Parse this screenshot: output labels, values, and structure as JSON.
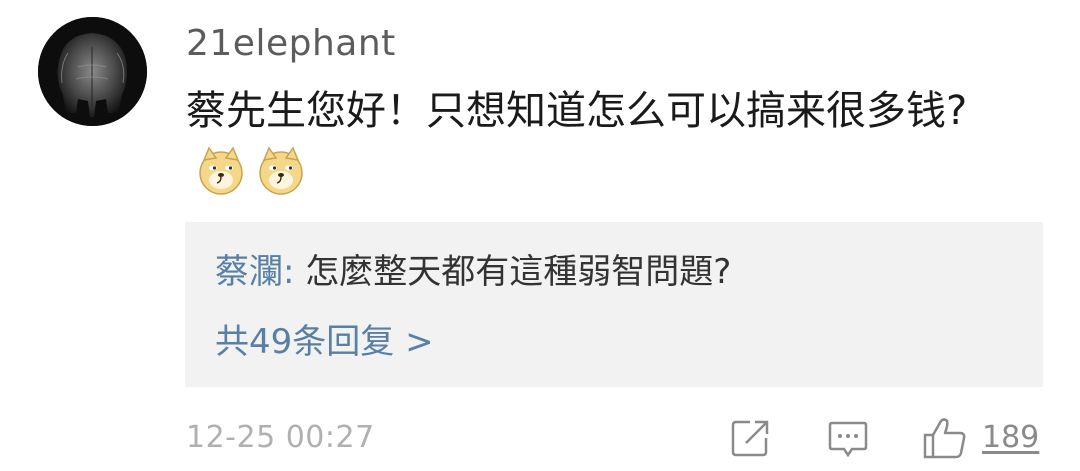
{
  "comment": {
    "username": "21elephant",
    "avatar_icon": "elephant-avatar",
    "text": "蔡先生您好！只想知道怎么可以搞来很多钱?",
    "emojis": [
      "doge-emoji",
      "doge-emoji"
    ]
  },
  "reply": {
    "author": "蔡瀾",
    "separator": ": ",
    "text": "怎麼整天都有這種弱智問題?",
    "count_label": "共49条回复 >"
  },
  "footer": {
    "timestamp": "12-25 00:27",
    "share_icon": "share-icon",
    "comment_icon": "comment-icon",
    "like_icon": "thumbs-up-icon",
    "like_count": "189"
  },
  "colors": {
    "link_blue": "#587fa4",
    "reply_bg": "#f2f2f2",
    "meta_gray": "#b0b0b0"
  }
}
